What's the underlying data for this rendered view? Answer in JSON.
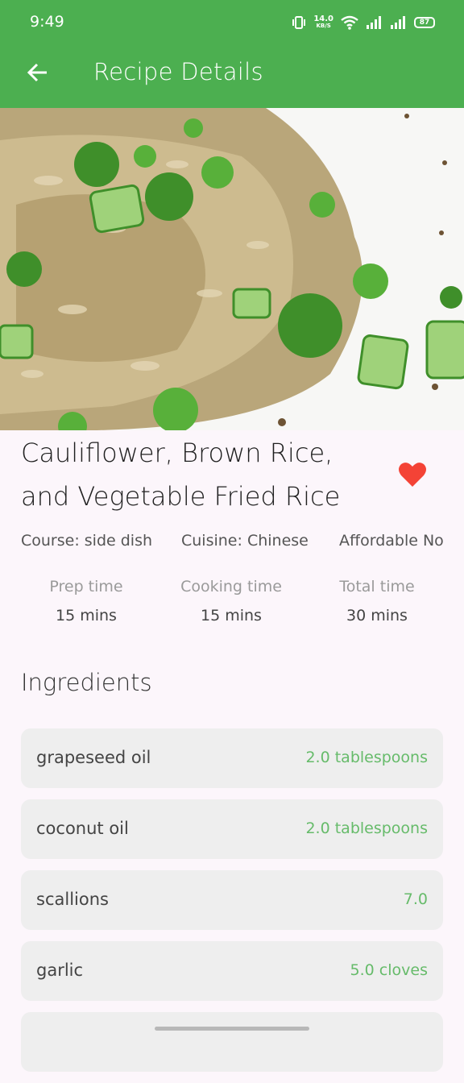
{
  "status_bar": {
    "time": "9:49",
    "net_speed_value": "14.0",
    "net_speed_unit": "KB/S",
    "battery": "87"
  },
  "app_bar": {
    "title": "Recipe Details",
    "back_icon": "arrow-left-icon"
  },
  "recipe": {
    "title": "Cauliflower, Brown Rice, and Vegetable Fried Rice",
    "favorite_icon": "heart-icon",
    "favorite_color": "#f44336",
    "course": "Course: side dish",
    "cuisine": "Cuisine: Chinese",
    "affordable": "Affordable No",
    "times": [
      {
        "label": "Prep time",
        "value": "15 mins"
      },
      {
        "label": "Cooking time",
        "value": "15 mins"
      },
      {
        "label": "Total time",
        "value": "30 mins"
      }
    ]
  },
  "ingredients": {
    "title": "Ingredients",
    "items": [
      {
        "name": "grapeseed oil",
        "quantity": "2.0 tablespoons"
      },
      {
        "name": "coconut oil",
        "quantity": "2.0 tablespoons"
      },
      {
        "name": "scallions",
        "quantity": "7.0"
      },
      {
        "name": "garlic",
        "quantity": "5.0 cloves"
      },
      {
        "name": "",
        "quantity": ""
      }
    ]
  },
  "colors": {
    "primary": "#4caf50",
    "accent_text": "#66bb6a"
  }
}
